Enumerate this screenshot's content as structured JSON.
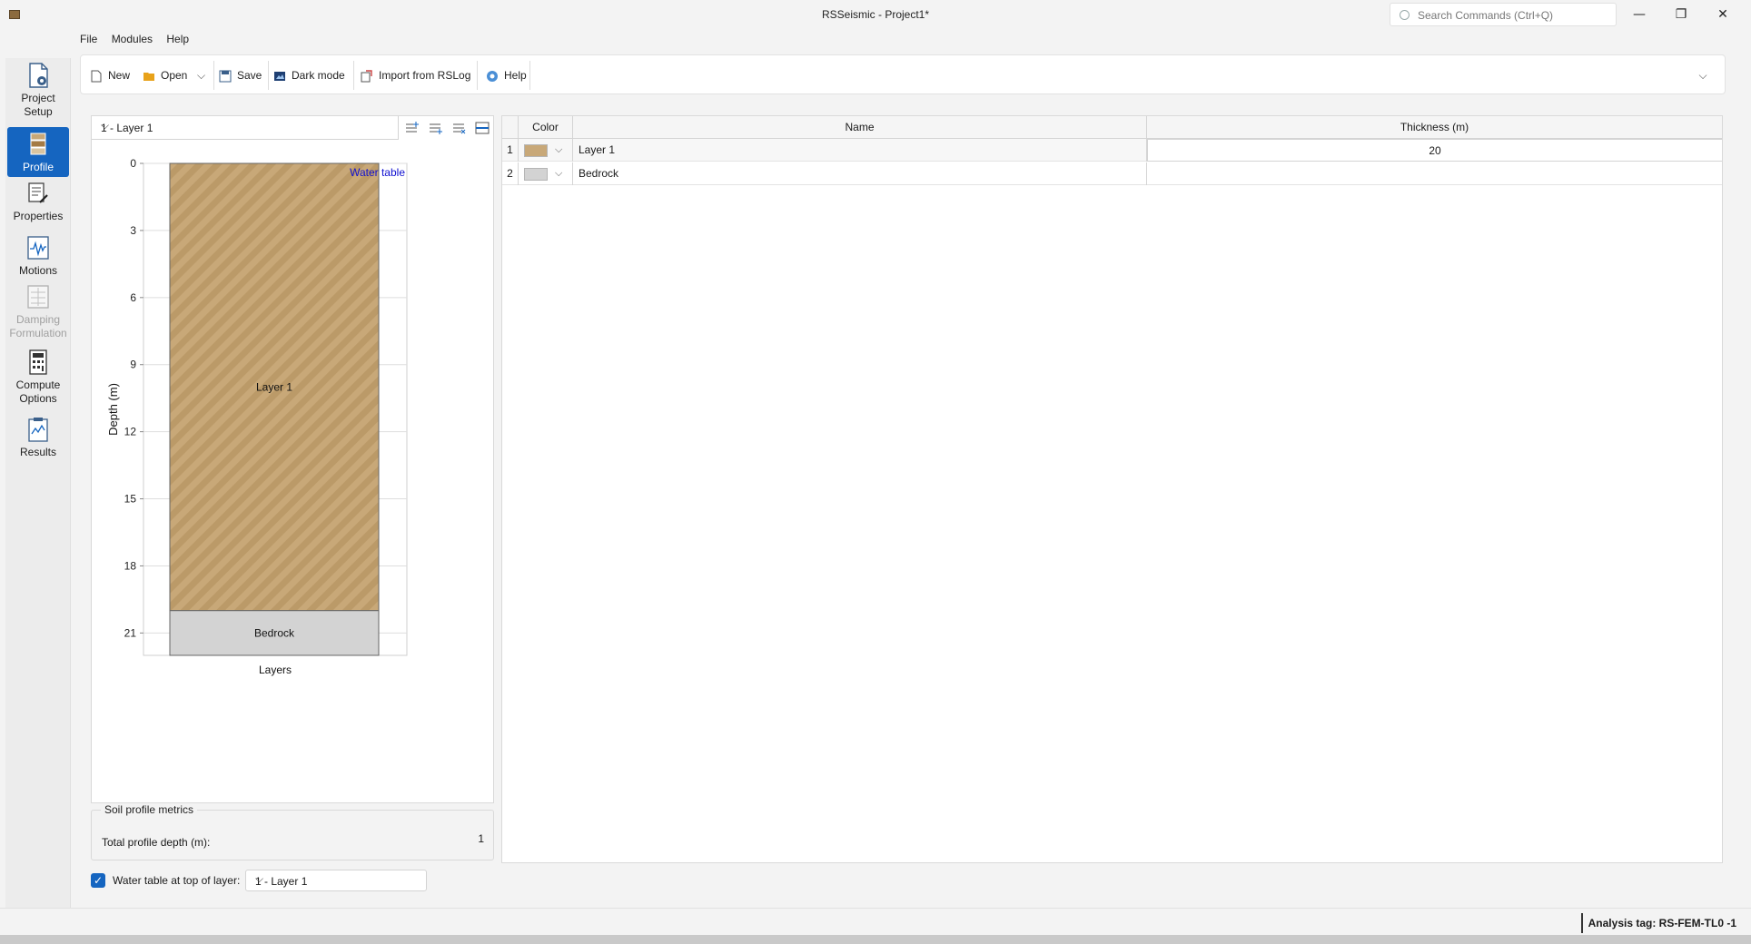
{
  "window": {
    "title": "RSSeismic - Project1*",
    "search_placeholder": "Search Commands (Ctrl+Q)",
    "minimize": "—",
    "maximize": "❐",
    "close": "✕"
  },
  "rail": [
    {
      "label_lines": [
        "Project",
        "Setup"
      ],
      "icon": "project-setup-icon",
      "state": "normal"
    },
    {
      "label_lines": [
        "Profile"
      ],
      "icon": "profile-icon",
      "state": "active"
    },
    {
      "label_lines": [
        "Properties"
      ],
      "icon": "properties-icon",
      "state": "normal"
    },
    {
      "label_lines": [
        "Motions"
      ],
      "icon": "motions-icon",
      "state": "normal"
    },
    {
      "label_lines": [
        "Damping",
        "Formulation"
      ],
      "icon": "damping-icon",
      "state": "disabled"
    },
    {
      "label_lines": [
        "Compute",
        "Options"
      ],
      "icon": "compute-icon",
      "state": "normal"
    },
    {
      "label_lines": [
        "Results"
      ],
      "icon": "results-icon",
      "state": "normal"
    }
  ],
  "menu": {
    "file": "File",
    "modules": "Modules",
    "help": "Help"
  },
  "toolbar": {
    "new": "New",
    "open": "Open",
    "save": "Save",
    "dark_mode": "Dark mode",
    "import": "Import from RSLog",
    "help": "Help"
  },
  "layer_selector": {
    "value": "1 - Layer 1"
  },
  "chart_data": {
    "type": "soil-profile",
    "ylabel": "Depth (m)",
    "xlabel": "Layers",
    "y_ticks": [
      0,
      3,
      6,
      9,
      12,
      15,
      18,
      21
    ],
    "y_range": [
      0,
      22
    ],
    "y_inverted": true,
    "grid": true,
    "water_table_label": "Water table",
    "water_table_depth": 0,
    "layers": [
      {
        "name": "Layer 1",
        "top": 0,
        "bottom": 20,
        "color": "#c8a878",
        "hatch": true
      },
      {
        "name": "Bedrock",
        "top": 20,
        "bottom": 22,
        "color": "#d3d3d3",
        "hatch": false
      }
    ]
  },
  "metrics": {
    "title": "Soil profile metrics",
    "total_depth_label": "Total profile depth (m):",
    "total_depth_value": "1"
  },
  "water_table": {
    "checked": true,
    "check_glyph": "✓",
    "label": "Water table at top of layer:",
    "value": "1 - Layer 1"
  },
  "grid": {
    "headers": {
      "color": "Color",
      "name": "Name",
      "thickness": "Thickness (m)"
    },
    "rows": [
      {
        "index": "1",
        "color": "#c8a878",
        "name": "Layer 1",
        "thickness": "20"
      },
      {
        "index": "2",
        "color": "#d3d3d3",
        "name": "Bedrock",
        "thickness": ""
      }
    ]
  },
  "status": {
    "analysis_tag": "Analysis tag: RS-FEM-TL0 -1"
  },
  "chevron": "⌵"
}
